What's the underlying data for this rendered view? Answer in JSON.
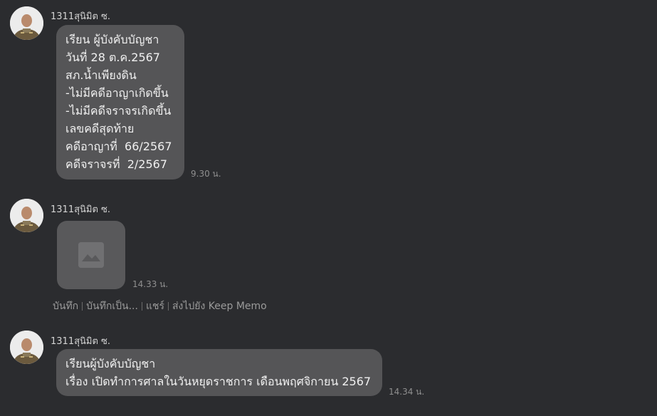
{
  "messages": [
    {
      "sender": "1311สุนิมิต ซ.",
      "lines": [
        "เรียน ผู้บังคับบัญชา",
        "วันที่ 28 ต.ค.2567",
        "สภ.น้ำเพียงดิน",
        "-ไม่มีคดีอาญาเกิดขึ้น",
        "-ไม่มีคดีจราจรเกิดขึ้น",
        "เลขคดีสุดท้าย",
        "คดีอาญาที่  66/2567",
        "คดีจราจรที่  2/2567"
      ],
      "time": "9.30 น."
    },
    {
      "sender": "1311สุนิมิต ซ.",
      "image_icon": "image-placeholder-icon",
      "time": "14.33 น.",
      "actions": [
        "บันทึก",
        "บันทึกเป็น...",
        "แชร์",
        "ส่งไปยัง Keep Memo"
      ]
    },
    {
      "sender": "1311สุนิมิต ซ.",
      "lines": [
        "เรียนผู้บังคับบัญชา",
        "เรื่อง เปิดทำการศาลในวันหยุดราชการ เดือนพฤศจิกายน 2567"
      ],
      "time": "14.34 น."
    }
  ],
  "colors": {
    "background": "#2b2c2f",
    "bubble": "#555557",
    "text": "#f0f0f0",
    "meta": "#8f8f8f"
  }
}
